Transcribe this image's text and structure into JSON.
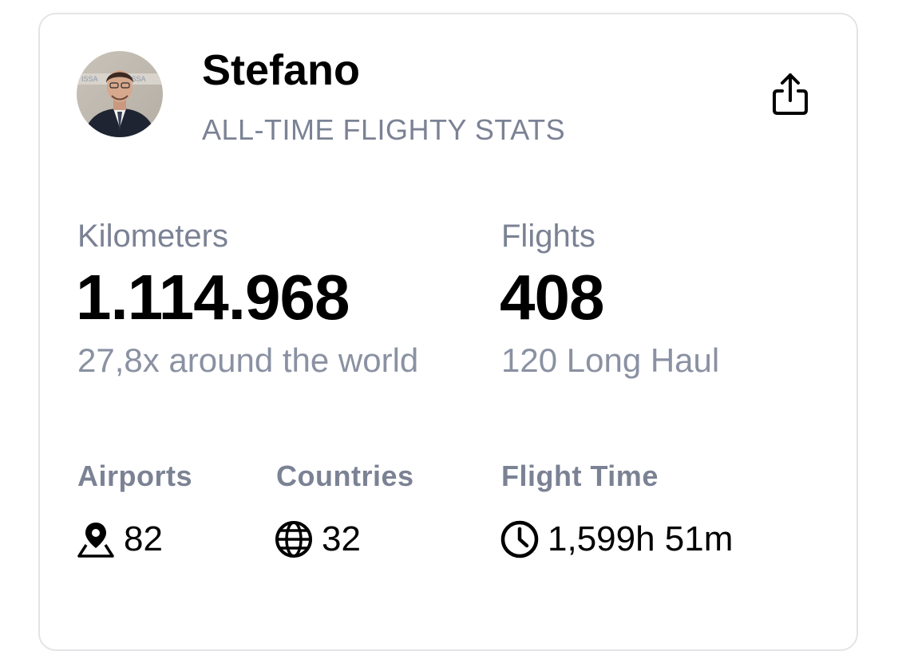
{
  "profile": {
    "name": "Stefano",
    "subtitle": "ALL-TIME FLIGHTY STATS",
    "avatar_icon": "avatar-photo",
    "share_icon": "share-icon"
  },
  "kilometers": {
    "label": "Kilometers",
    "value": "1.114.968",
    "sub": "27,8x around the world"
  },
  "flights": {
    "label": "Flights",
    "value": "408",
    "sub": "120 Long Haul"
  },
  "airports": {
    "label": "Airports",
    "value": "82",
    "icon": "map-pin-icon"
  },
  "countries": {
    "label": "Countries",
    "value": "32",
    "icon": "globe-icon"
  },
  "flight_time": {
    "label": "Flight Time",
    "value": "1,599h 51m",
    "icon": "clock-icon"
  },
  "colors": {
    "primary_text": "#000000",
    "secondary_text": "#7b8294",
    "card_border": "#e4e4e8"
  }
}
